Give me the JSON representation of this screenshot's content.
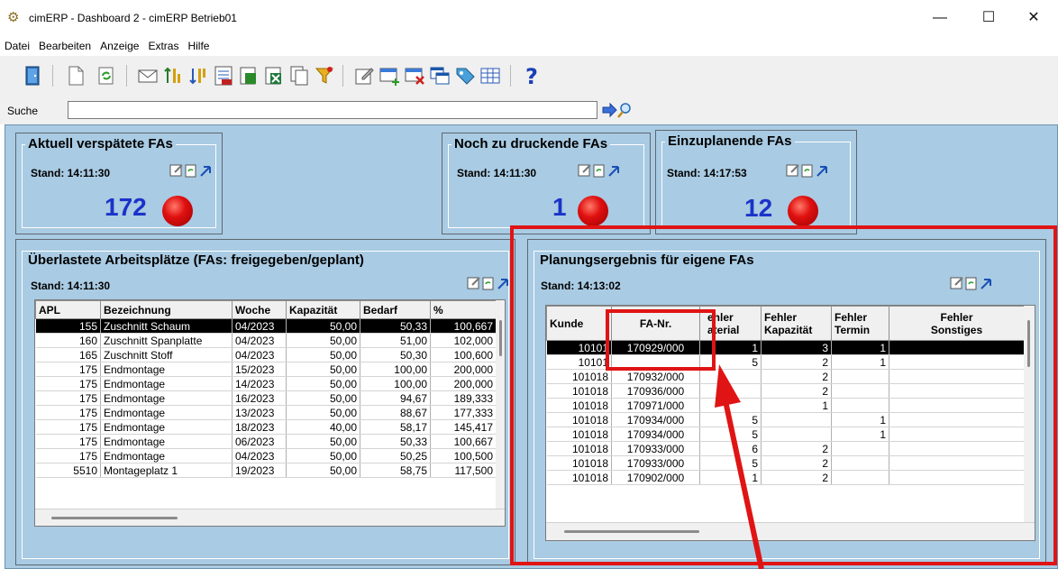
{
  "window": {
    "title": "cimERP - Dashboard 2 - cimERP  Betrieb01",
    "minimize": "—",
    "maximize": "☐",
    "close": "✕"
  },
  "menu": [
    "Datei",
    "Bearbeiten",
    "Anzeige",
    "Extras",
    "Hilfe"
  ],
  "search": {
    "label": "Suche",
    "value": ""
  },
  "panels": {
    "verspaetet": {
      "title": "Aktuell verspätete FAs",
      "stand": "Stand: 14:11:30",
      "count": "172"
    },
    "drucken": {
      "title": "Noch zu druckende FAs",
      "stand": "Stand: 14:11:30",
      "count": "1"
    },
    "einplanen": {
      "title": "Einzuplanende FAs",
      "stand": "Stand: 14:17:53",
      "count": "12"
    }
  },
  "ueberlastet": {
    "title": "Überlastete Arbeitsplätze (FAs: freigegeben/geplant)",
    "stand": "Stand: 14:11:30",
    "columns": [
      "APL",
      "Bezeichnung",
      "Woche",
      "Kapazität",
      "Bedarf",
      "%"
    ],
    "rows": [
      [
        "155",
        "Zuschnitt Schaum",
        "04/2023",
        "50,00",
        "50,33",
        "100,667"
      ],
      [
        "160",
        "Zuschnitt Spanplatte",
        "04/2023",
        "50,00",
        "51,00",
        "102,000"
      ],
      [
        "165",
        "Zuschnitt Stoff",
        "04/2023",
        "50,00",
        "50,30",
        "100,600"
      ],
      [
        "175",
        "Endmontage",
        "15/2023",
        "50,00",
        "100,00",
        "200,000"
      ],
      [
        "175",
        "Endmontage",
        "14/2023",
        "50,00",
        "100,00",
        "200,000"
      ],
      [
        "175",
        "Endmontage",
        "16/2023",
        "50,00",
        "94,67",
        "189,333"
      ],
      [
        "175",
        "Endmontage",
        "13/2023",
        "50,00",
        "88,67",
        "177,333"
      ],
      [
        "175",
        "Endmontage",
        "18/2023",
        "40,00",
        "58,17",
        "145,417"
      ],
      [
        "175",
        "Endmontage",
        "06/2023",
        "50,00",
        "50,33",
        "100,667"
      ],
      [
        "175",
        "Endmontage",
        "04/2023",
        "50,00",
        "50,25",
        "100,500"
      ],
      [
        "5510",
        "Montageplatz 1",
        "19/2023",
        "50,00",
        "58,75",
        "117,500"
      ]
    ]
  },
  "planung": {
    "title": "Planungsergebnis für eigene FAs",
    "stand": "Stand: 14:13:02",
    "columns": [
      "Kunde",
      "FA-Nr.",
      "Fehler Material",
      "Fehler Kapazität",
      "Fehler Termin",
      "Fehler Sonstiges"
    ],
    "header_visible": {
      "kunde": "Kunde",
      "fanr": "FA-Nr.",
      "mat1": "ehler",
      "mat2": "aterial",
      "kap1": "Fehler",
      "kap2": "Kapazität",
      "ter1": "Fehler",
      "ter2": "Termin",
      "son1": "Fehler",
      "son2": "Sonstiges"
    },
    "rows": [
      [
        "10101",
        "170929/000",
        "1",
        "3",
        "1",
        ""
      ],
      [
        "10101",
        "",
        "5",
        "2",
        "1",
        ""
      ],
      [
        "101018",
        "170932/000",
        "",
        "2",
        "",
        ""
      ],
      [
        "101018",
        "170936/000",
        "",
        "2",
        "",
        ""
      ],
      [
        "101018",
        "170971/000",
        "",
        "1",
        "",
        ""
      ],
      [
        "101018",
        "170934/000",
        "5",
        "",
        "1",
        ""
      ],
      [
        "101018",
        "170934/000",
        "5",
        "",
        "1",
        ""
      ],
      [
        "101018",
        "170933/000",
        "6",
        "2",
        "",
        ""
      ],
      [
        "101018",
        "170933/000",
        "5",
        "2",
        "",
        ""
      ],
      [
        "101018",
        "170902/000",
        "1",
        "2",
        "",
        ""
      ]
    ]
  },
  "colors": {
    "dashboard_bg": "#a9cbe3",
    "highlight": "#e01414",
    "count_blue": "#1b33c9",
    "led_red": "#e01010"
  }
}
